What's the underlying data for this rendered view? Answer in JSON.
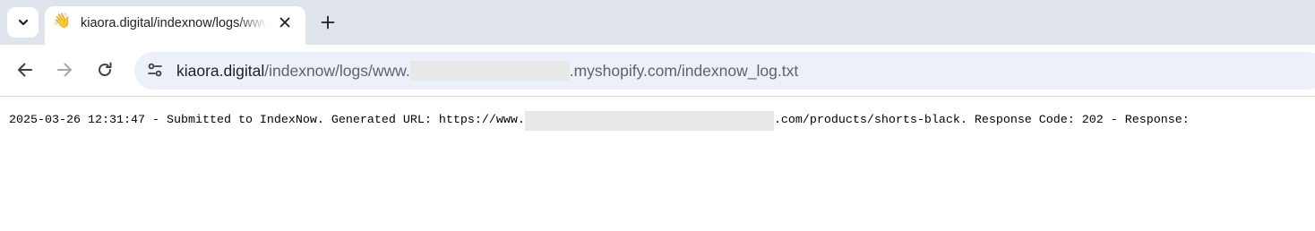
{
  "browser": {
    "tab": {
      "favicon": "waving-hand-emoji",
      "favicon_glyph": "👋",
      "title": "kiaora.digital/indexnow/logs/www.",
      "close_icon": "close-icon"
    },
    "new_tab_icon": "plus-icon",
    "tab_search_icon": "chevron-down-icon",
    "nav": {
      "back_icon": "back-arrow-icon",
      "forward_icon": "forward-arrow-icon",
      "reload_icon": "reload-icon",
      "forward_enabled": false
    },
    "address_bar": {
      "site_info_icon": "tune-icon",
      "host": "kiaora.digital",
      "path_prefix": "/indexnow/logs/www.",
      "redacted": true,
      "path_suffix": ".myshopify.com/indexnow_log.txt"
    }
  },
  "page": {
    "log_line_prefix": "2025-03-26 12:31:47 - Submitted to IndexNow. Generated URL: https://www.",
    "redacted": true,
    "log_line_suffix": ".com/products/shorts-black. Response Code: 202 - Response:"
  },
  "colors": {
    "tabstrip_bg": "#dfe3eb",
    "omnibox_bg": "#ecf1f9",
    "redaction": "#e8e8e8",
    "text": "#1f1f1f",
    "url_path": "#5f6368"
  }
}
